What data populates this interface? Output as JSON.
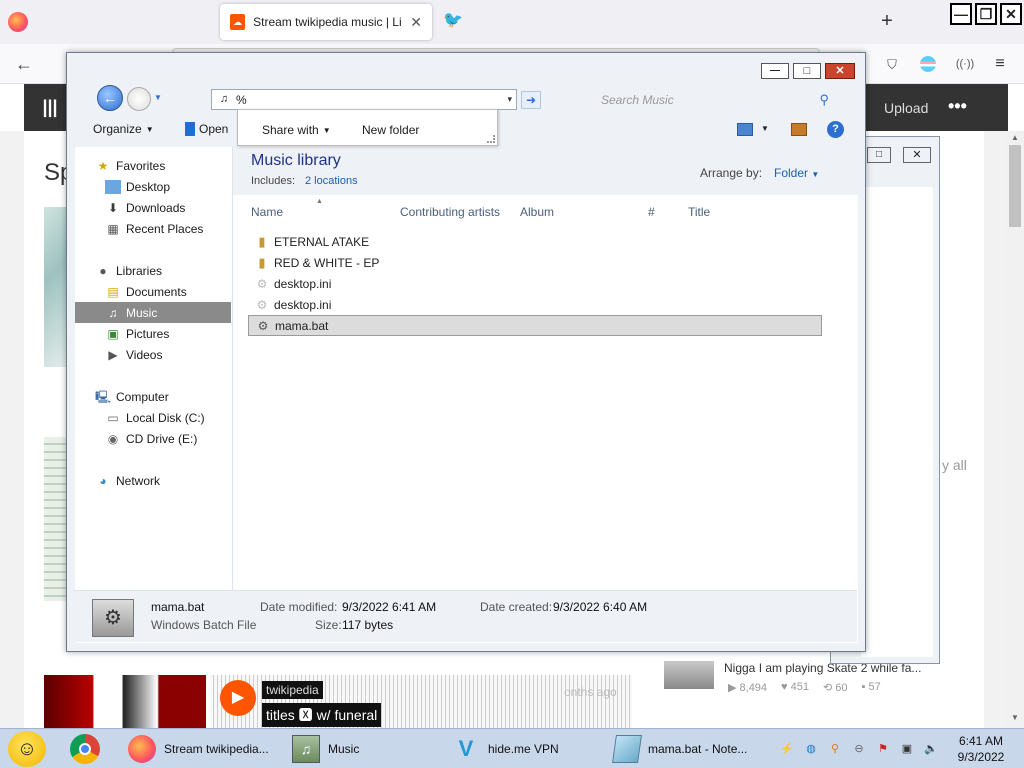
{
  "browser": {
    "tab_active_title": "Stream twikipedia music | List",
    "new_tab_icon": "plus-icon",
    "window_controls": {
      "minimize": "minimize-icon",
      "restore": "restore-icon",
      "close": "close-icon"
    }
  },
  "soundcloud": {
    "upload_label": "Upload",
    "more_label": "•••",
    "heading_partial": "Sp",
    "view_all_partial": "y all",
    "track_user": "twikipedia",
    "track_title": "titles 🆇 w/ funeral",
    "track_time_partial": "onths ago",
    "related_title": "Nigga I am playing Skate 2 while fa...",
    "related_plays": "8,494",
    "related_likes": "451",
    "related_reposts": "60",
    "related_comments": "57"
  },
  "explorer": {
    "address_value": "%",
    "search_placeholder": "Search Music",
    "toolbar": {
      "organize": "Organize",
      "open": "Open",
      "share_with": "Share with",
      "new_folder": "New folder"
    },
    "nav": {
      "favorites": "Favorites",
      "desktop": "Desktop",
      "downloads": "Downloads",
      "recent_places": "Recent Places",
      "libraries": "Libraries",
      "documents": "Documents",
      "music": "Music",
      "pictures": "Pictures",
      "videos": "Videos",
      "computer": "Computer",
      "local_disk": "Local Disk (C:)",
      "cd_drive": "CD Drive (E:)",
      "network": "Network"
    },
    "library_title": "Music library",
    "includes_label": "Includes:",
    "includes_link": "2 locations",
    "arrange_label": "Arrange by:",
    "arrange_value": "Folder",
    "columns": [
      "Name",
      "Contributing artists",
      "Album",
      "#",
      "Title"
    ],
    "files": [
      {
        "name": "ETERNAL ATAKE",
        "icon": "music-folder-icon"
      },
      {
        "name": "RED & WHITE - EP",
        "icon": "music-folder-icon"
      },
      {
        "name": "desktop.ini",
        "icon": "ini-file-icon"
      },
      {
        "name": "desktop.ini",
        "icon": "ini-file-icon"
      },
      {
        "name": "mama.bat",
        "icon": "batch-file-icon"
      }
    ],
    "details": {
      "filename": "mama.bat",
      "filetype": "Windows Batch File",
      "modified_label": "Date modified:",
      "modified_value": "9/3/2022 6:41 AM",
      "created_label": "Date created:",
      "created_value": "9/3/2022 6:40 AM",
      "size_label": "Size:",
      "size_value": "117 bytes"
    }
  },
  "taskbar": {
    "apps": {
      "firefox_label": "Stream twikipedia...",
      "music_label": "Music",
      "vpn_label": "hide.me VPN",
      "notepad_label": "mama.bat - Note..."
    },
    "clock_time": "6:41 AM",
    "clock_date": "9/3/2022"
  }
}
